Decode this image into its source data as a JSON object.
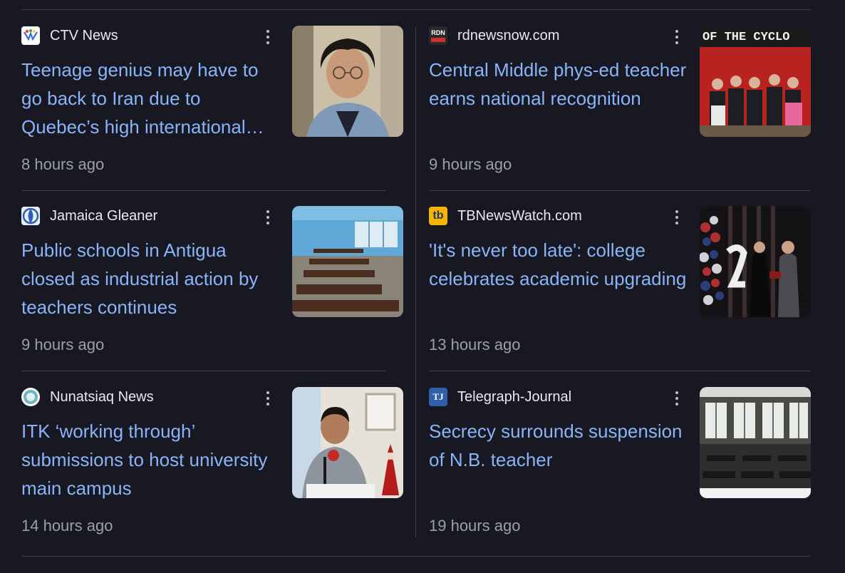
{
  "articles": [
    {
      "source": "CTV News",
      "logo": "ctv-news-logo",
      "headline": "Teenage genius may have to go back to Iran due to Quebec’s high international…",
      "time": "8 hours ago",
      "thumbnail": "teen-portrait-photo"
    },
    {
      "source": "rdnewsnow.com",
      "logo": "rdn-logo",
      "logo_text": "RDN",
      "headline": "Central Middle phys-ed teacher earns national recognition",
      "time": "9 hours ago",
      "thumbnail": "school-group-photo",
      "thumbnail_text": "OF THE CYCLO"
    },
    {
      "source": "Jamaica Gleaner",
      "logo": "jamaica-gleaner-logo",
      "headline": "Public schools in Antigua closed as industrial action by teachers continues",
      "time": "9 hours ago",
      "thumbnail": "empty-classroom-photo"
    },
    {
      "source": "TBNewsWatch.com",
      "logo": "tbnewswatch-logo",
      "logo_text": "tb",
      "headline": "'It's never too late': college celebrates academic upgrading",
      "time": "13 hours ago",
      "thumbnail": "graduation-ceremony-photo"
    },
    {
      "source": "Nunatsiaq News",
      "logo": "nunatsiaq-logo",
      "headline": "ITK ‘working through’ submissions to host university main campus",
      "time": "14 hours ago",
      "thumbnail": "press-conference-photo"
    },
    {
      "source": "Telegraph-Journal",
      "logo": "telegraph-journal-logo",
      "logo_text": "TJ",
      "headline": "Secrecy surrounds suspension of N.B. teacher",
      "time": "19 hours ago",
      "thumbnail": "school-interior-photo"
    }
  ],
  "menu_icon": "more-vert-icon",
  "colors": {
    "background": "#171821",
    "headline": "#8ab4f8",
    "source": "#e8eaed",
    "time": "#9aa0a6",
    "divider": "#3c4043"
  }
}
